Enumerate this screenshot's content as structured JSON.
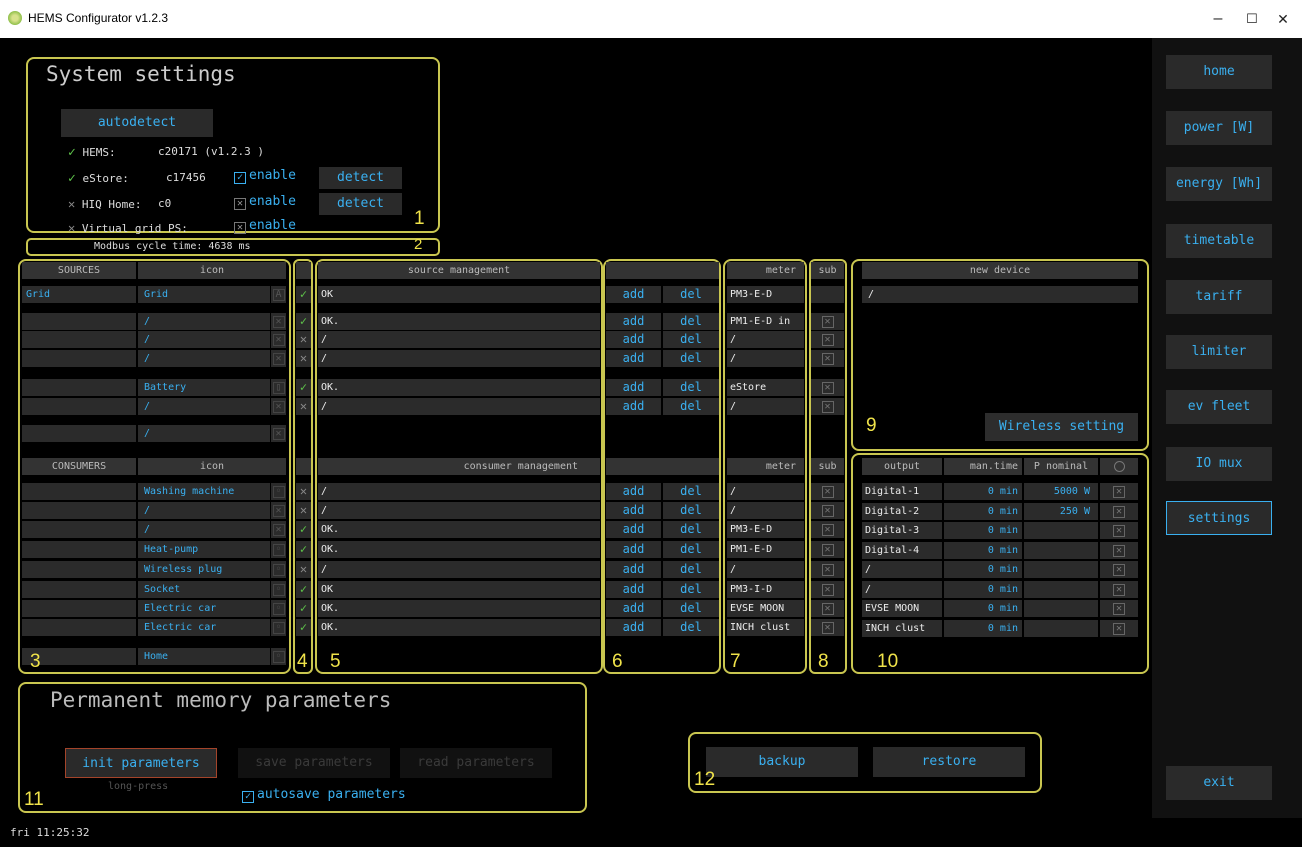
{
  "window": {
    "title": "HEMS Configurator v1.2.3",
    "minimize": "–",
    "maximize": "☐",
    "close": "✕"
  },
  "nav": [
    "home",
    "power [W]",
    "energy [Wh]",
    "timetable",
    "tariff",
    "limiter",
    "ev fleet",
    "IO mux",
    "settings",
    "exit"
  ],
  "system": {
    "title": "System settings",
    "autodetect": "autodetect",
    "hems_label": "HEMS:",
    "hems_value": "c20171 (v1.2.3 )",
    "estore_label": "eStore:",
    "estore_value": "c17456",
    "enable": "enable",
    "detect": "detect",
    "hiq_label": "HIQ Home:",
    "hiq_value": "c0",
    "vgrid_label": "Virtual grid PS:",
    "modbus": "Modbus cycle time: 4638 ms"
  },
  "labels": {
    "n1": "1",
    "n2": "2",
    "n3": "3",
    "n4": "4",
    "n5": "5",
    "n6": "6",
    "n7": "7",
    "n8": "8",
    "n9": "9",
    "n10": "10",
    "n11": "11",
    "n12": "12"
  },
  "sources": {
    "h_sources": "SOURCES",
    "h_icon": "icon",
    "h_mgmt": "source management",
    "h_meter": "meter",
    "h_sub": "sub",
    "rows": [
      {
        "name": "Grid",
        "icon": "Grid",
        "status": "OK",
        "meter": "PM3-E-D"
      },
      {
        "name": "",
        "icon": "/",
        "status": "OK.",
        "meter": "PM1-E-D in"
      },
      {
        "name": "",
        "icon": "/",
        "status": "/",
        "meter": "/"
      },
      {
        "name": "",
        "icon": "/",
        "status": "/",
        "meter": "/"
      },
      {
        "name": "",
        "icon": "Battery",
        "status": "OK.",
        "meter": "eStore"
      },
      {
        "name": "",
        "icon": "/",
        "status": "/",
        "meter": "/"
      },
      {
        "name": "",
        "icon": "/",
        "status": "",
        "meter": ""
      }
    ]
  },
  "consumers": {
    "h_consumers": "CONSUMERS",
    "h_icon": "icon",
    "h_mgmt": "consumer management",
    "h_meter": "meter",
    "h_sub": "sub",
    "rows": [
      {
        "icon": "Washing machine",
        "status": "/",
        "meter": "/"
      },
      {
        "icon": "/",
        "status": "/",
        "meter": "/"
      },
      {
        "icon": "/",
        "status": "OK.",
        "meter": "PM3-E-D"
      },
      {
        "icon": "Heat-pump",
        "status": "OK.",
        "meter": "PM1-E-D"
      },
      {
        "icon": "Wireless plug",
        "status": "/",
        "meter": "/"
      },
      {
        "icon": "Socket",
        "status": "OK",
        "meter": "PM3-I-D"
      },
      {
        "icon": "Electric car",
        "status": "OK.",
        "meter": "EVSE MOON"
      },
      {
        "icon": "Electric car",
        "status": "OK.",
        "meter": "INCH clust"
      },
      {
        "icon": "Home",
        "status": "",
        "meter": ""
      }
    ]
  },
  "add": "add",
  "del": "del",
  "newdev": {
    "header": "new device",
    "value": "/",
    "wireless": "Wireless setting"
  },
  "outputs": {
    "h_output": "output",
    "h_mantime": "man.time",
    "h_pnom": "P nominal",
    "rows": [
      {
        "output": "Digital-1",
        "mantime": "0 min",
        "pnom": "5000 W"
      },
      {
        "output": "Digital-2",
        "mantime": "0 min",
        "pnom": "250 W"
      },
      {
        "output": "Digital-3",
        "mantime": "0 min",
        "pnom": ""
      },
      {
        "output": "Digital-4",
        "mantime": "0 min",
        "pnom": ""
      },
      {
        "output": "/",
        "mantime": "0 min",
        "pnom": ""
      },
      {
        "output": "/",
        "mantime": "0 min",
        "pnom": ""
      },
      {
        "output": "EVSE MOON",
        "mantime": "0 min",
        "pnom": ""
      },
      {
        "output": "INCH clust",
        "mantime": "0 min",
        "pnom": ""
      }
    ]
  },
  "memory": {
    "title": "Permanent memory parameters",
    "init": "init parameters",
    "longpress": "long-press",
    "save": "save parameters",
    "read": "read parameters",
    "autosave": "autosave parameters"
  },
  "backup": {
    "backup": "backup",
    "restore": "restore"
  },
  "status": {
    "clock": "fri 11:25:32"
  }
}
